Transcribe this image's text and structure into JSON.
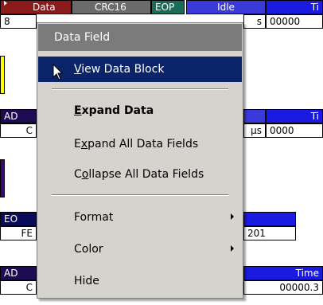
{
  "background": {
    "row1_headers": {
      "data": "Data",
      "crc": "CRC16",
      "eop": "EOP",
      "idle": "Idle",
      "time": "Ti"
    },
    "row1_values": {
      "first": "8",
      "idle_unit": "s",
      "time": "00000"
    },
    "row2_headers": {
      "ad": "AD",
      "time": "Ti"
    },
    "row2_values": {
      "first": "C",
      "idle_unit": "µs",
      "time": "0000"
    },
    "row3_headers": {
      "eo": "EO"
    },
    "row3_values": {
      "first": "FE",
      "mid": "201"
    },
    "row4_headers": {
      "ad": "AD",
      "time": "Time"
    },
    "row4_values": {
      "first": "C",
      "time": "00000.3"
    },
    "colors": {
      "data_header": "#8b1a1a",
      "crc_header": "#6b6b6b",
      "eop_header": "#1a6b5a",
      "idle_header": "#3a3ad8",
      "time_header": "#1a1ae0",
      "ad_header": "#1e0a52",
      "yellow_strip": "#ffff00",
      "purple_strip": "#3a0a6a"
    }
  },
  "context_menu": {
    "title": "Data Field",
    "items": [
      {
        "label": "View Data Block",
        "mnemonic": "V",
        "state": "highlighted"
      },
      {
        "label": "Expand Data",
        "mnemonic": "E",
        "style": "bold"
      },
      {
        "label": "Expand All Data Fields",
        "mnemonic": "x"
      },
      {
        "label": "Collapse All Data Fields",
        "mnemonic": "o"
      },
      {
        "label": "Format",
        "submenu": true
      },
      {
        "label": "Color",
        "submenu": true
      },
      {
        "label": "Hide"
      }
    ],
    "colors": {
      "background": "#d6d3ce",
      "highlight": "#0a246a",
      "title_bar": "#7b7b7b"
    }
  },
  "cursor_icon": "arrow-pointer-icon"
}
